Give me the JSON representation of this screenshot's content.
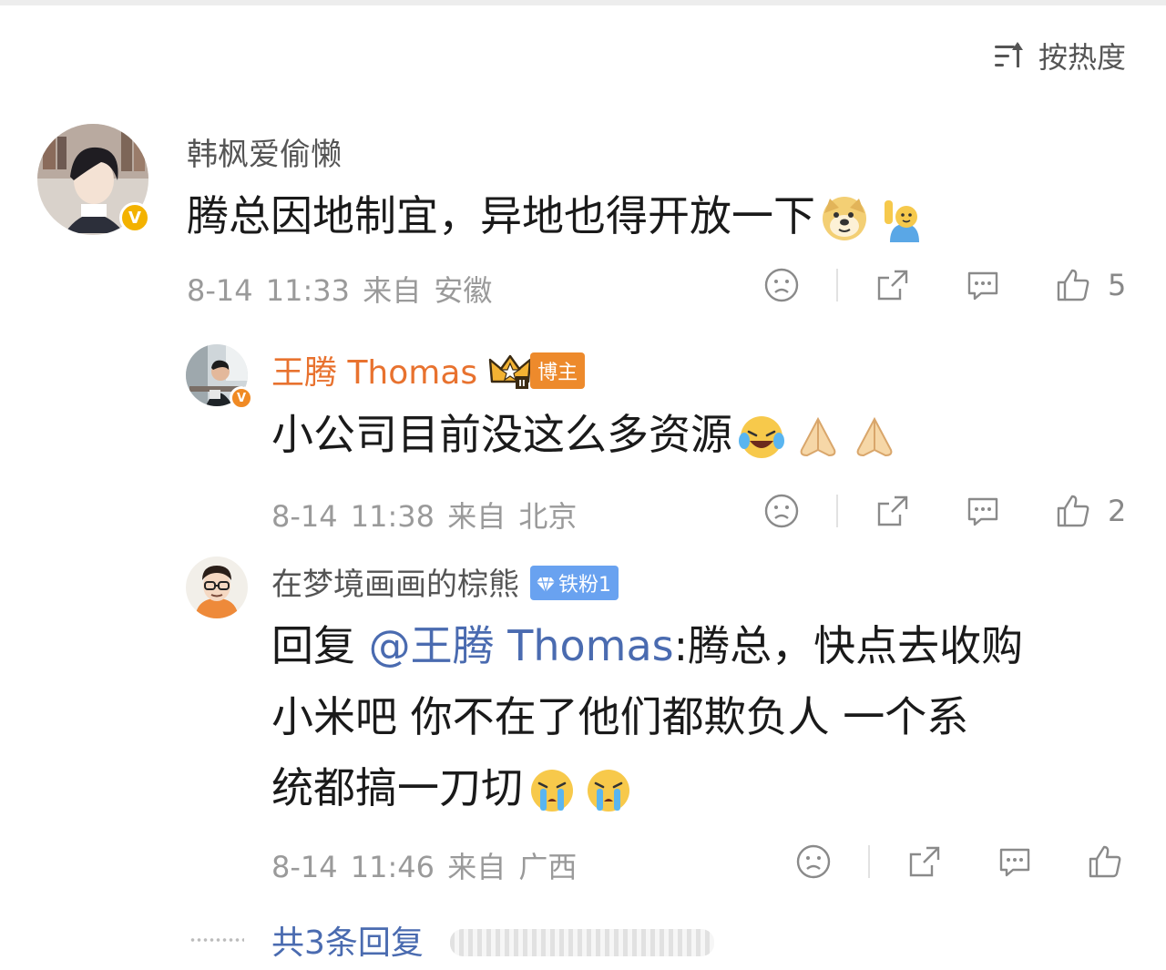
{
  "sort": {
    "label": "按热度",
    "icon": "sort-descending-icon"
  },
  "comments": [
    {
      "author": "韩枫爱偷懒",
      "content": "腾总因地制宜，异地也得开放一下",
      "date": "8-14 11:33",
      "source": "来自 安徽",
      "likes": "5",
      "emojis": [
        "doge-emoji",
        "raise-hand-emoji"
      ]
    },
    {
      "author": "王腾 Thomas",
      "tag": "博主",
      "content": "小公司目前没这么多资源",
      "date": "8-14 11:38",
      "source": "来自 北京",
      "likes": "2",
      "emojis": [
        "laugh-cry-emoji",
        "pray-hands-emoji",
        "pray-hands-emoji"
      ]
    },
    {
      "author": "在梦境画画的棕熊",
      "fan_tag": "铁粉1",
      "reply_prefix": "回复 ",
      "mention": "@王腾 Thomas",
      "line1": ":腾总，快点去收购",
      "line2": "小米吧  你不在了他们都欺负人 一个系",
      "line3": "统都搞一刀切",
      "date": "8-14 11:46",
      "source": "来自 广西",
      "likes": "",
      "emojis": [
        "crying-emoji",
        "crying-emoji"
      ]
    }
  ],
  "more_replies": "共3条回复",
  "colors": {
    "link": "#4a6bb0",
    "blogger_name": "#e8722f",
    "verified_badge": "#f3b200",
    "fan_badge": "#69a2f0"
  }
}
